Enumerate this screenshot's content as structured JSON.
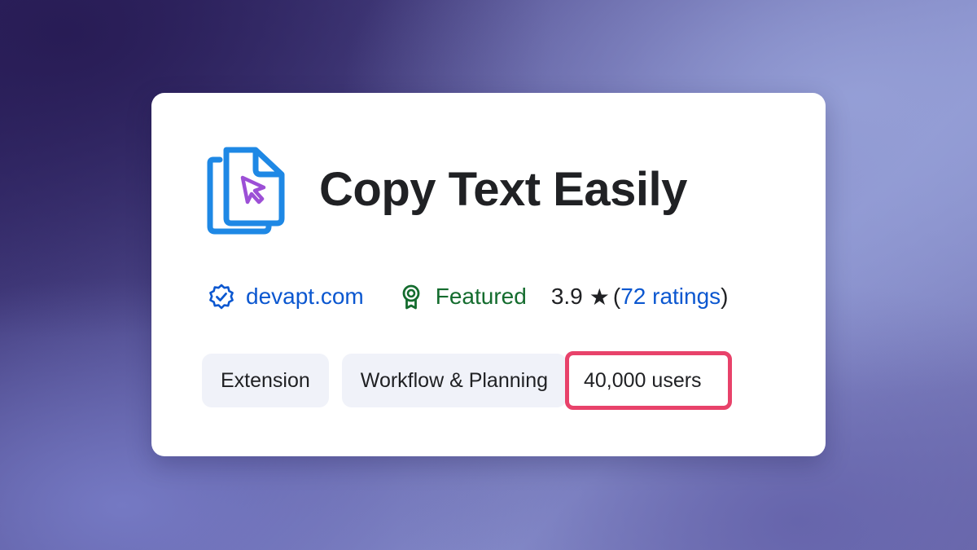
{
  "extension": {
    "title": "Copy Text Easily",
    "icon": "copy-document-cursor-icon"
  },
  "meta": {
    "publisher": "devapt.com",
    "publisher_icon": "verified-badge-icon",
    "featured_label": "Featured",
    "featured_icon": "award-ribbon-icon",
    "rating_value": "3.9",
    "rating_star": "★",
    "rating_open": "(",
    "ratings_count_label": "72 ratings",
    "rating_close": ")"
  },
  "chips": {
    "type": "Extension",
    "category": "Workflow & Planning",
    "users": "40,000 users"
  },
  "colors": {
    "link": "#0b57d0",
    "featured": "#146c2e",
    "highlight": "#e8426a",
    "icon_blue": "#1e88e5",
    "cursor_purple": "#9c4fd6"
  }
}
